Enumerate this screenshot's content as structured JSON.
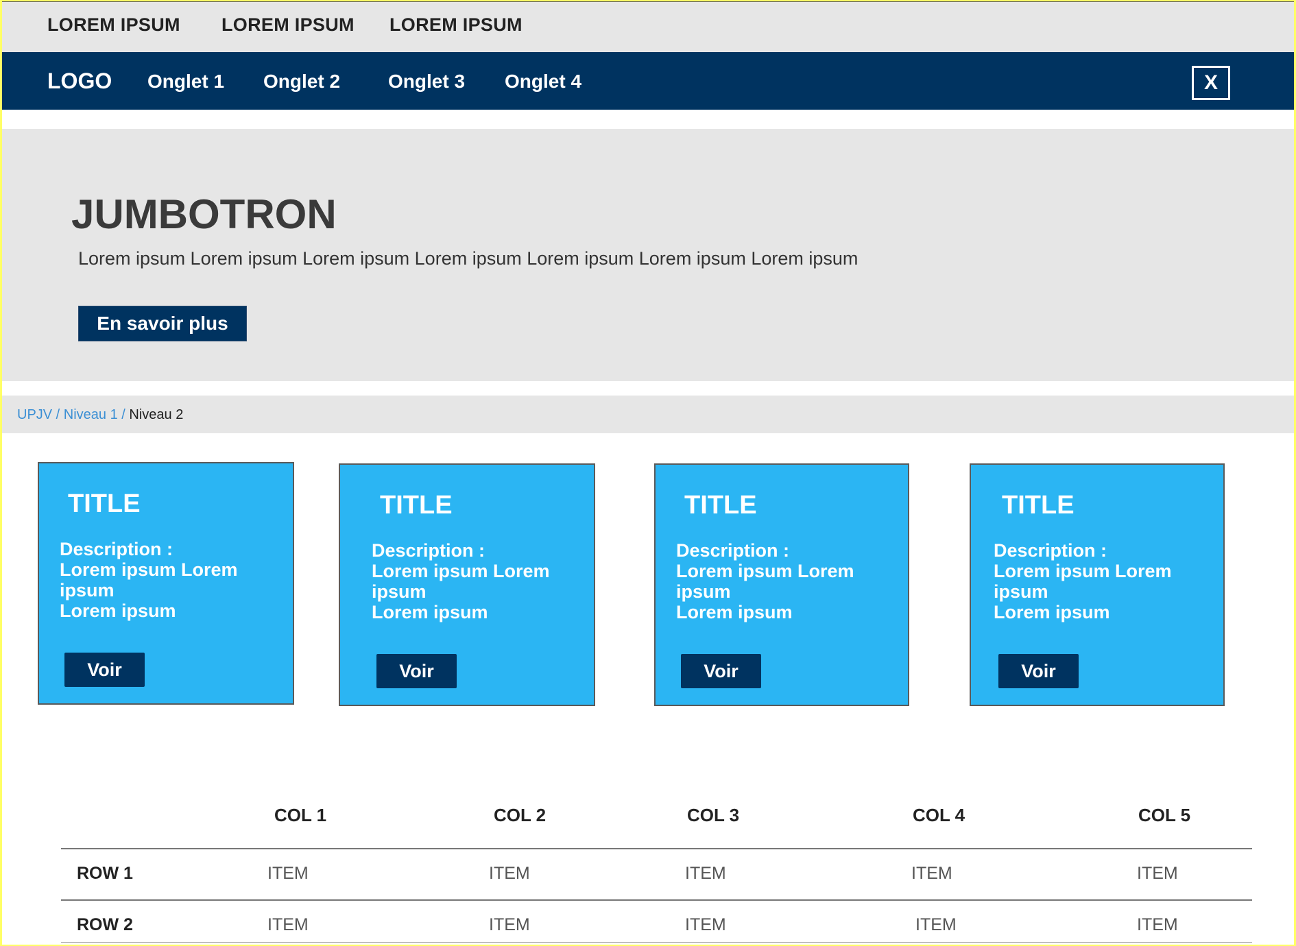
{
  "top_bar": {
    "links": [
      "LOREM IPSUM",
      "LOREM IPSUM",
      "LOREM IPSUM"
    ]
  },
  "nav": {
    "logo": "LOGO",
    "tabs": [
      "Onglet 1",
      "Onglet 2",
      "Onglet 3",
      "Onglet 4"
    ],
    "close_label": "X"
  },
  "jumbotron": {
    "title": "JUMBOTRON",
    "text": "Lorem ipsum Lorem ipsum Lorem ipsum Lorem ipsum Lorem ipsum Lorem ipsum Lorem ipsum",
    "button": "En savoir plus"
  },
  "breadcrumb": {
    "items": [
      "UPJV",
      "Niveau 1"
    ],
    "separator": " / ",
    "current": "Niveau 2"
  },
  "cards": [
    {
      "title": "TITLE",
      "desc_label": "Description :",
      "desc_lines": [
        "Lorem ipsum Lorem ipsum",
        "Lorem ipsum"
      ],
      "button": "Voir"
    },
    {
      "title": "TITLE",
      "desc_label": "Description :",
      "desc_lines": [
        "Lorem ipsum Lorem ipsum",
        "Lorem ipsum"
      ],
      "button": "Voir"
    },
    {
      "title": "TITLE",
      "desc_label": "Description :",
      "desc_lines": [
        "Lorem ipsum Lorem ipsum",
        "Lorem ipsum"
      ],
      "button": "Voir"
    },
    {
      "title": "TITLE",
      "desc_label": "Description :",
      "desc_lines": [
        "Lorem ipsum Lorem ipsum",
        "Lorem ipsum"
      ],
      "button": "Voir"
    }
  ],
  "table": {
    "headers": [
      "COL 1",
      "COL 2",
      "COL 3",
      "COL 4",
      "COL 5"
    ],
    "rows": [
      {
        "label": "ROW 1",
        "cells": [
          "ITEM",
          "ITEM",
          "ITEM",
          "ITEM",
          "ITEM"
        ]
      },
      {
        "label": "ROW 2",
        "cells": [
          "ITEM",
          "ITEM",
          "ITEM",
          "ITEM",
          "ITEM"
        ]
      }
    ]
  },
  "colors": {
    "nav_bg": "#003360",
    "card_bg": "#2bb5f3",
    "panel_bg": "#e6e6e6",
    "link": "#3b8fd4",
    "frame": "#ffff66"
  }
}
